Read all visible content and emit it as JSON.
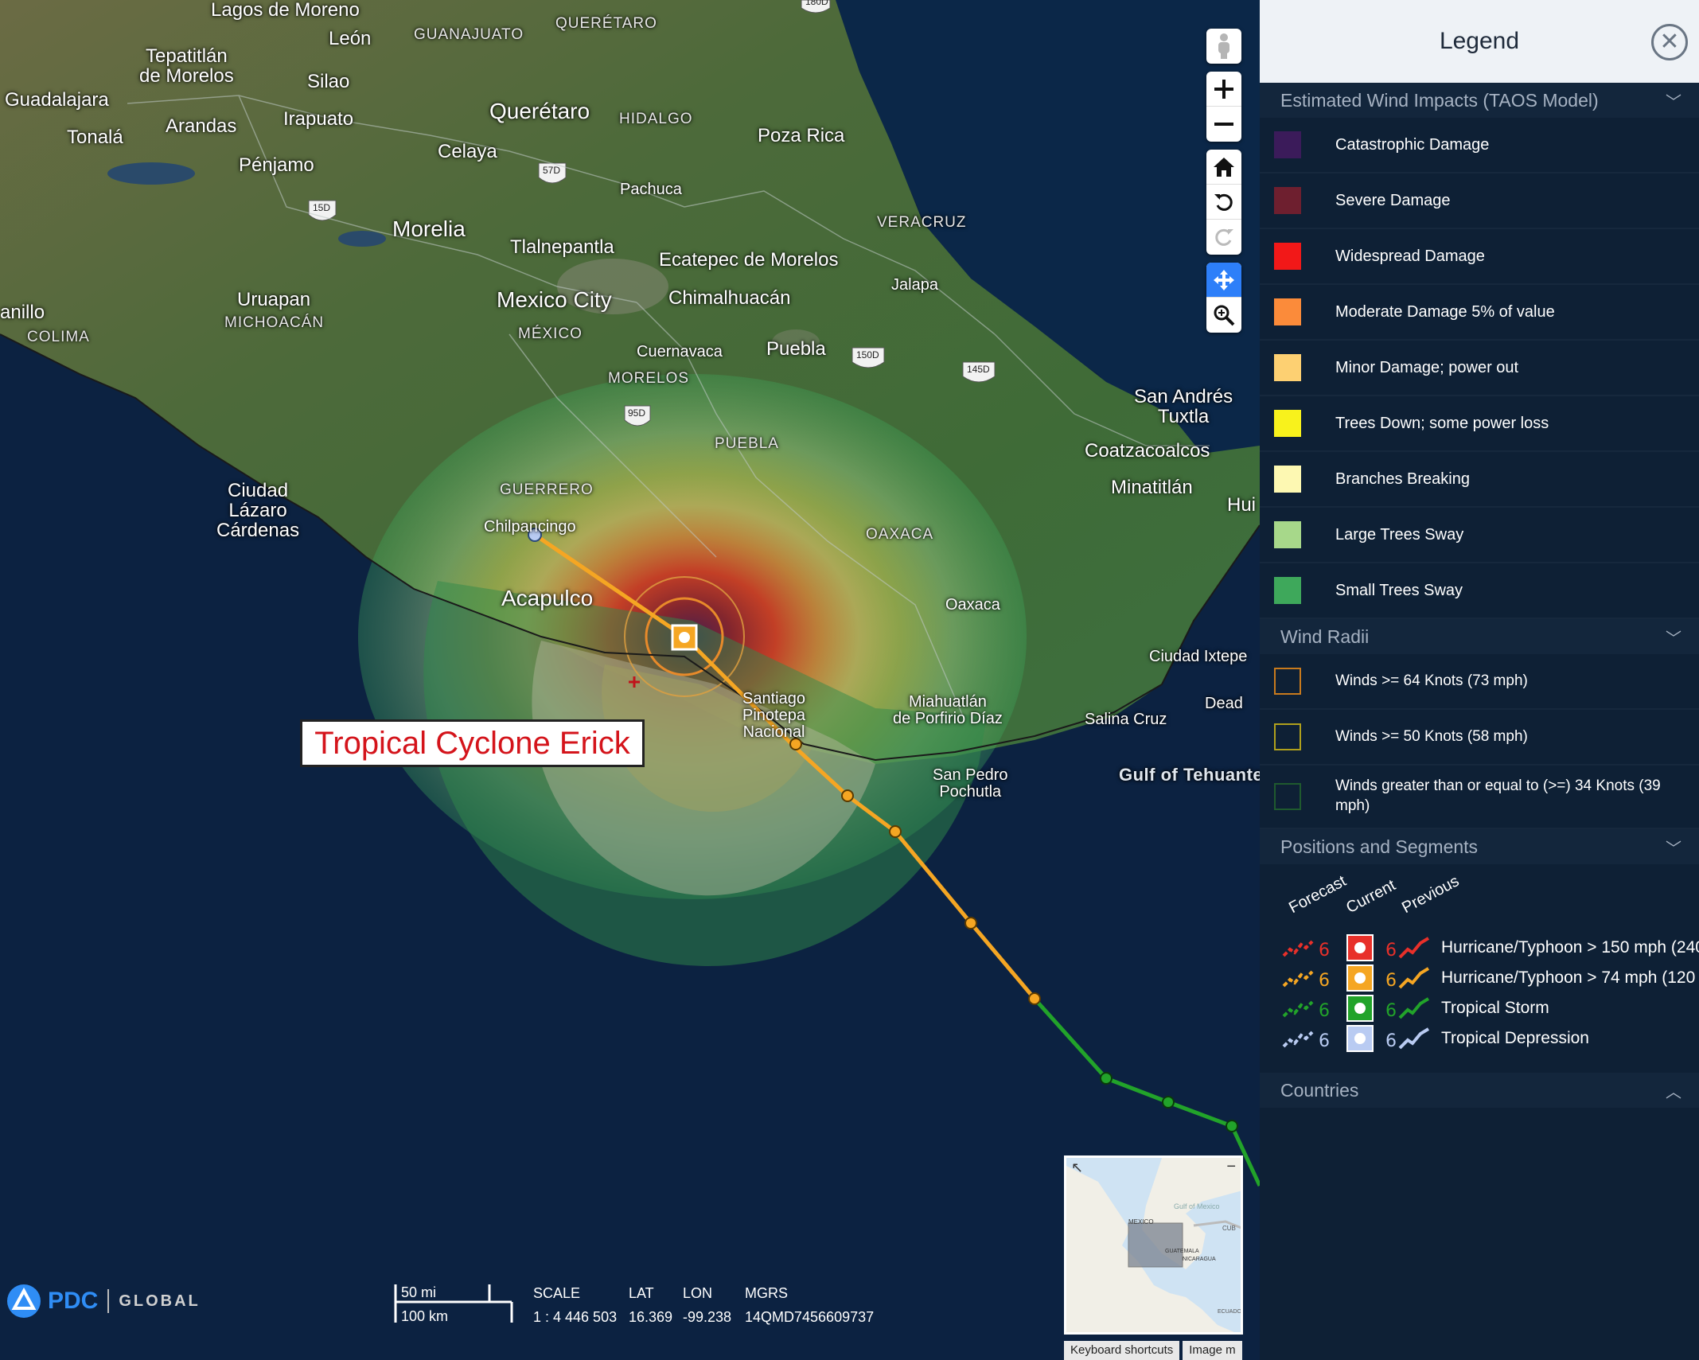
{
  "map": {
    "places": [
      {
        "id": "lagos-de-moreno",
        "text": "Lagos de Moreno",
        "size": "mid"
      },
      {
        "id": "queretaro-state",
        "text": "QUERÉTARO",
        "size": "state"
      },
      {
        "id": "tepatitlan",
        "text": "Tepatitlán\nde Morelos",
        "size": "mid"
      },
      {
        "id": "leon",
        "text": "León",
        "size": "mid"
      },
      {
        "id": "guanajuato",
        "text": "GUANAJUATO",
        "size": "state"
      },
      {
        "id": "silao",
        "text": "Silao",
        "size": "mid"
      },
      {
        "id": "guadalajara",
        "text": "Guadalajara",
        "size": "mid"
      },
      {
        "id": "tonala",
        "text": "Tonalá",
        "size": "mid"
      },
      {
        "id": "arandas",
        "text": "Arandas",
        "size": "mid"
      },
      {
        "id": "irapuato",
        "text": "Irapuato",
        "size": "mid"
      },
      {
        "id": "queretaro-city",
        "text": "Querétaro",
        "size": "big"
      },
      {
        "id": "hidalgo",
        "text": "HIDALGO",
        "size": "state"
      },
      {
        "id": "poza-rica",
        "text": "Poza Rica",
        "size": "mid"
      },
      {
        "id": "celaya",
        "text": "Celaya",
        "size": "mid"
      },
      {
        "id": "penjamo",
        "text": "Pénjamo",
        "size": "mid"
      },
      {
        "id": "pachuca",
        "text": "Pachuca",
        "size": "sm"
      },
      {
        "id": "morelia",
        "text": "Morelia",
        "size": "big"
      },
      {
        "id": "veracruz",
        "text": "VERACRUZ",
        "size": "state"
      },
      {
        "id": "tlalnepantla",
        "text": "Tlalnepantla",
        "size": "mid"
      },
      {
        "id": "ecatepec",
        "text": "Ecatepec de Morelos",
        "size": "mid"
      },
      {
        "id": "uruapan",
        "text": "Uruapan",
        "size": "mid"
      },
      {
        "id": "michoacan",
        "text": "MICHOACÁN",
        "size": "state"
      },
      {
        "id": "mexico-city",
        "text": "Mexico City",
        "size": "big"
      },
      {
        "id": "chimalhuacan",
        "text": "Chimalhuacán",
        "size": "mid"
      },
      {
        "id": "jalapa",
        "text": "Jalapa",
        "size": "sm"
      },
      {
        "id": "anillo",
        "text": "anillo",
        "size": "mid"
      },
      {
        "id": "colima",
        "text": "COLIMA",
        "size": "state"
      },
      {
        "id": "mexico-state",
        "text": "MÉXICO",
        "size": "state"
      },
      {
        "id": "cuernavaca",
        "text": "Cuernavaca",
        "size": "sm"
      },
      {
        "id": "puebla-city",
        "text": "Puebla",
        "size": "mid"
      },
      {
        "id": "morelos",
        "text": "MORELOS",
        "size": "state"
      },
      {
        "id": "san-andres",
        "text": "San Andrés\nTuxtla",
        "size": "mid"
      },
      {
        "id": "puebla-state",
        "text": "PUEBLA",
        "size": "state"
      },
      {
        "id": "coatzacoalcos",
        "text": "Coatzacoalcos",
        "size": "mid"
      },
      {
        "id": "ciudad-lazaro",
        "text": "Ciudad\nLázaro\nCárdenas",
        "size": "mid"
      },
      {
        "id": "guerrero",
        "text": "GUERRERO",
        "size": "state"
      },
      {
        "id": "minatitlan",
        "text": "Minatitlán",
        "size": "mid"
      },
      {
        "id": "hui",
        "text": "Hui",
        "size": "mid"
      },
      {
        "id": "chilpancingo",
        "text": "Chilpancingo",
        "size": "sm"
      },
      {
        "id": "oaxaca-state",
        "text": "OAXACA",
        "size": "state"
      },
      {
        "id": "acapulco",
        "text": "Acapulco",
        "size": "big"
      },
      {
        "id": "oaxaca-city",
        "text": "Oaxaca",
        "size": "sm"
      },
      {
        "id": "ciudad-ixtepec",
        "text": "Ciudad Ixtepe",
        "size": "sm"
      },
      {
        "id": "santiago",
        "text": "Santiago\nPinotepa\nNacional",
        "size": "sm"
      },
      {
        "id": "miahuatlan",
        "text": "Miahuatlán\nde Porfirio Díaz",
        "size": "sm"
      },
      {
        "id": "salina-cruz",
        "text": "Salina Cruz",
        "size": "sm"
      },
      {
        "id": "dead",
        "text": "Dead",
        "size": "sm"
      },
      {
        "id": "san-pedro",
        "text": "San Pedro\nPochutla",
        "size": "sm"
      },
      {
        "id": "gulf-tehuantepec",
        "text": "Gulf of Tehuante",
        "size": "water"
      },
      {
        "id": "hwy-180d",
        "text": "180D",
        "size": "shield"
      },
      {
        "id": "hwy-57d",
        "text": "57D",
        "size": "shield"
      },
      {
        "id": "hwy-15d",
        "text": "15D",
        "size": "shield"
      },
      {
        "id": "hwy-150d",
        "text": "150D",
        "size": "shield"
      },
      {
        "id": "hwy-145d",
        "text": "145D",
        "size": "shield"
      },
      {
        "id": "hwy-95d",
        "text": "95D",
        "size": "shield"
      }
    ],
    "storm_label": "Tropical Cyclone Erick",
    "track_colors": {
      "hurricane": "#f5a623",
      "tropical_storm": "#22a32a"
    },
    "toolbar": [
      {
        "name": "street-view-icon"
      },
      {
        "name": "zoom-in-icon"
      },
      {
        "name": "zoom-out-icon"
      },
      {
        "name": "home-icon"
      },
      {
        "name": "rotate-left-icon"
      },
      {
        "name": "rotate-right-icon"
      },
      {
        "name": "pan-icon"
      },
      {
        "name": "zoom-box-icon"
      }
    ]
  },
  "footer": {
    "logo_text": "PDC",
    "logo_sub": "GLOBAL",
    "scale_mi": "50 mi",
    "scale_km": "100 km",
    "scale_label": "SCALE",
    "scale_value": "1 : 4 446 503",
    "lat_label": "LAT",
    "lat_value": "16.369",
    "lon_label": "LON",
    "lon_value": "-99.238",
    "mgrs_label": "MGRS",
    "mgrs_value": "14QMD7456609737"
  },
  "overview": {
    "labels": [
      "Gulf of Mexico",
      "MEXICO",
      "CUB",
      "GUATEMALA",
      "NICARAGUA",
      "ECUADO"
    ],
    "footer_links": [
      "Keyboard shortcuts",
      "Image m"
    ]
  },
  "legend": {
    "title": "Legend",
    "sections": {
      "wind_impacts": {
        "title": "Estimated Wind Impacts (TAOS Model)",
        "items": [
          {
            "label": "Catastrophic Damage",
            "color": "#3b1b5a"
          },
          {
            "label": "Severe Damage",
            "color": "#6e1f2f"
          },
          {
            "label": "Widespread Damage",
            "color": "#f21818"
          },
          {
            "label": "Moderate Damage 5% of value",
            "color": "#fb8b3a"
          },
          {
            "label": "Minor Damage; power out",
            "color": "#fdd072"
          },
          {
            "label": "Trees Down; some power loss",
            "color": "#f8f21c"
          },
          {
            "label": "Branches Breaking",
            "color": "#fdf8b2"
          },
          {
            "label": "Large Trees Sway",
            "color": "#a7d88a"
          },
          {
            "label": "Small Trees Sway",
            "color": "#3ea85b"
          }
        ]
      },
      "wind_radii": {
        "title": "Wind Radii",
        "items": [
          {
            "label": "Winds >= 64 Knots (73 mph)",
            "color": "#c87a1d"
          },
          {
            "label": "Winds >= 50 Knots (58 mph)",
            "color": "#b0a01c"
          },
          {
            "label": "Winds greater than or equal to (>=) 34 Knots (39 mph)",
            "color": "#1f5a2e"
          }
        ]
      },
      "positions": {
        "title": "Positions and Segments",
        "headers": [
          "Forecast",
          "Current",
          "Previous"
        ],
        "rows": [
          {
            "label": "Hurricane/Typhoon > 150 mph (240",
            "color": "#e8302a"
          },
          {
            "label": "Hurricane/Typhoon > 74 mph (120",
            "color": "#f5a623"
          },
          {
            "label": "Tropical Storm",
            "color": "#22a32a"
          },
          {
            "label": "Tropical Depression",
            "color": "#b9cbf2"
          }
        ]
      },
      "countries": {
        "title": "Countries"
      }
    }
  }
}
